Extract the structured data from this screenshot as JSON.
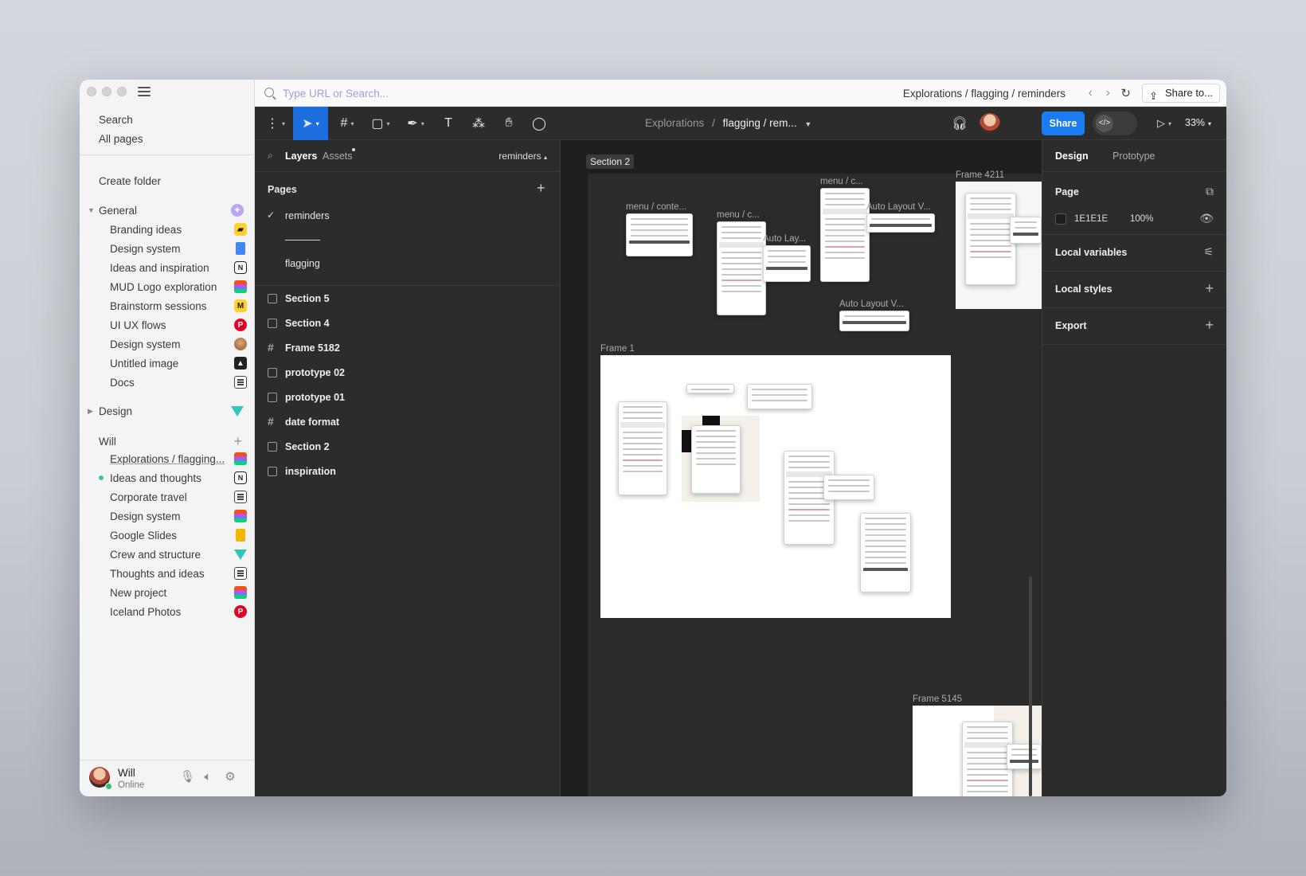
{
  "sidebar": {
    "search_label": "Search",
    "all_pages_label": "All pages",
    "create_folder_label": "Create folder",
    "groups": [
      {
        "name": "General",
        "icon": "sparkle-icon",
        "items": [
          {
            "label": "Branding ideas",
            "icon": "miro-icon"
          },
          {
            "label": "Design system",
            "icon": "google-docs-icon"
          },
          {
            "label": "Ideas and inspiration",
            "icon": "notion-icon"
          },
          {
            "label": "MUD Logo exploration",
            "icon": "figma-icon"
          },
          {
            "label": "Brainstorm sessions",
            "icon": "miro-icon"
          },
          {
            "label": "UI UX flows",
            "icon": "pinterest-icon"
          },
          {
            "label": "Design system",
            "icon": "photo-icon"
          },
          {
            "label": "Untitled image",
            "icon": "image-icon"
          },
          {
            "label": "Docs",
            "icon": "document-icon"
          }
        ]
      },
      {
        "name": "Design",
        "icon": "triangle-icon",
        "items": []
      },
      {
        "name": "Will",
        "icon": "plus-icon",
        "items": [
          {
            "label": "Explorations / flagging...",
            "icon": "figma-icon"
          },
          {
            "label": "Ideas and thoughts",
            "icon": "notion-icon"
          },
          {
            "label": "Corporate travel",
            "icon": "document-icon"
          },
          {
            "label": "Design system",
            "icon": "figma-icon"
          },
          {
            "label": "Google Slides",
            "icon": "google-slides-icon"
          },
          {
            "label": "Crew and structure",
            "icon": "triangle-icon"
          },
          {
            "label": "Thoughts and ideas",
            "icon": "document-icon"
          },
          {
            "label": "New project",
            "icon": "figma-icon"
          },
          {
            "label": "Iceland Photos",
            "icon": "pinterest-icon"
          }
        ]
      }
    ],
    "user": {
      "name": "Will",
      "status": "Online"
    }
  },
  "browser": {
    "url_placeholder": "Type URL or Search...",
    "path": "Explorations / flagging / reminders",
    "share_label": "Share to..."
  },
  "toolbar": {
    "breadcrumb_project": "Explorations",
    "breadcrumb_separator": "/",
    "breadcrumb_file": "flagging / rem...",
    "share_label": "Share",
    "zoom": "33%"
  },
  "layers_panel": {
    "tab_layers": "Layers",
    "tab_assets": "Assets",
    "current_page": "reminders",
    "pages_heading": "Pages",
    "pages": [
      {
        "label": "reminders",
        "selected": true
      },
      {
        "label": "———",
        "divider": true
      },
      {
        "label": "flagging",
        "selected": false
      }
    ],
    "layers": [
      {
        "label": "Section 5",
        "type": "section"
      },
      {
        "label": "Section 4",
        "type": "section"
      },
      {
        "label": "Frame 5182",
        "type": "frame"
      },
      {
        "label": "prototype 02",
        "type": "section"
      },
      {
        "label": "prototype 01",
        "type": "section"
      },
      {
        "label": "date format",
        "type": "frame"
      },
      {
        "label": "Section 2",
        "type": "section"
      },
      {
        "label": "inspiration",
        "type": "section"
      }
    ]
  },
  "canvas": {
    "section_label": "Section 2",
    "labels": {
      "menu_content": "menu / conte...",
      "menu_c1": "menu / c...",
      "menu_c2": "menu / c...",
      "auto_layout_1": "Auto Lay...",
      "auto_layout_2": "Auto Layout V...",
      "auto_layout_3": "Auto Layout V...",
      "frame_4211": "Frame 4211",
      "frame_1": "Frame 1",
      "frame_5145": "Frame 5145"
    }
  },
  "design_panel": {
    "tab_design": "Design",
    "tab_prototype": "Prototype",
    "page_heading": "Page",
    "page_color": "1E1E1E",
    "page_opacity": "100%",
    "local_variables": "Local variables",
    "local_styles": "Local styles",
    "export": "Export"
  }
}
